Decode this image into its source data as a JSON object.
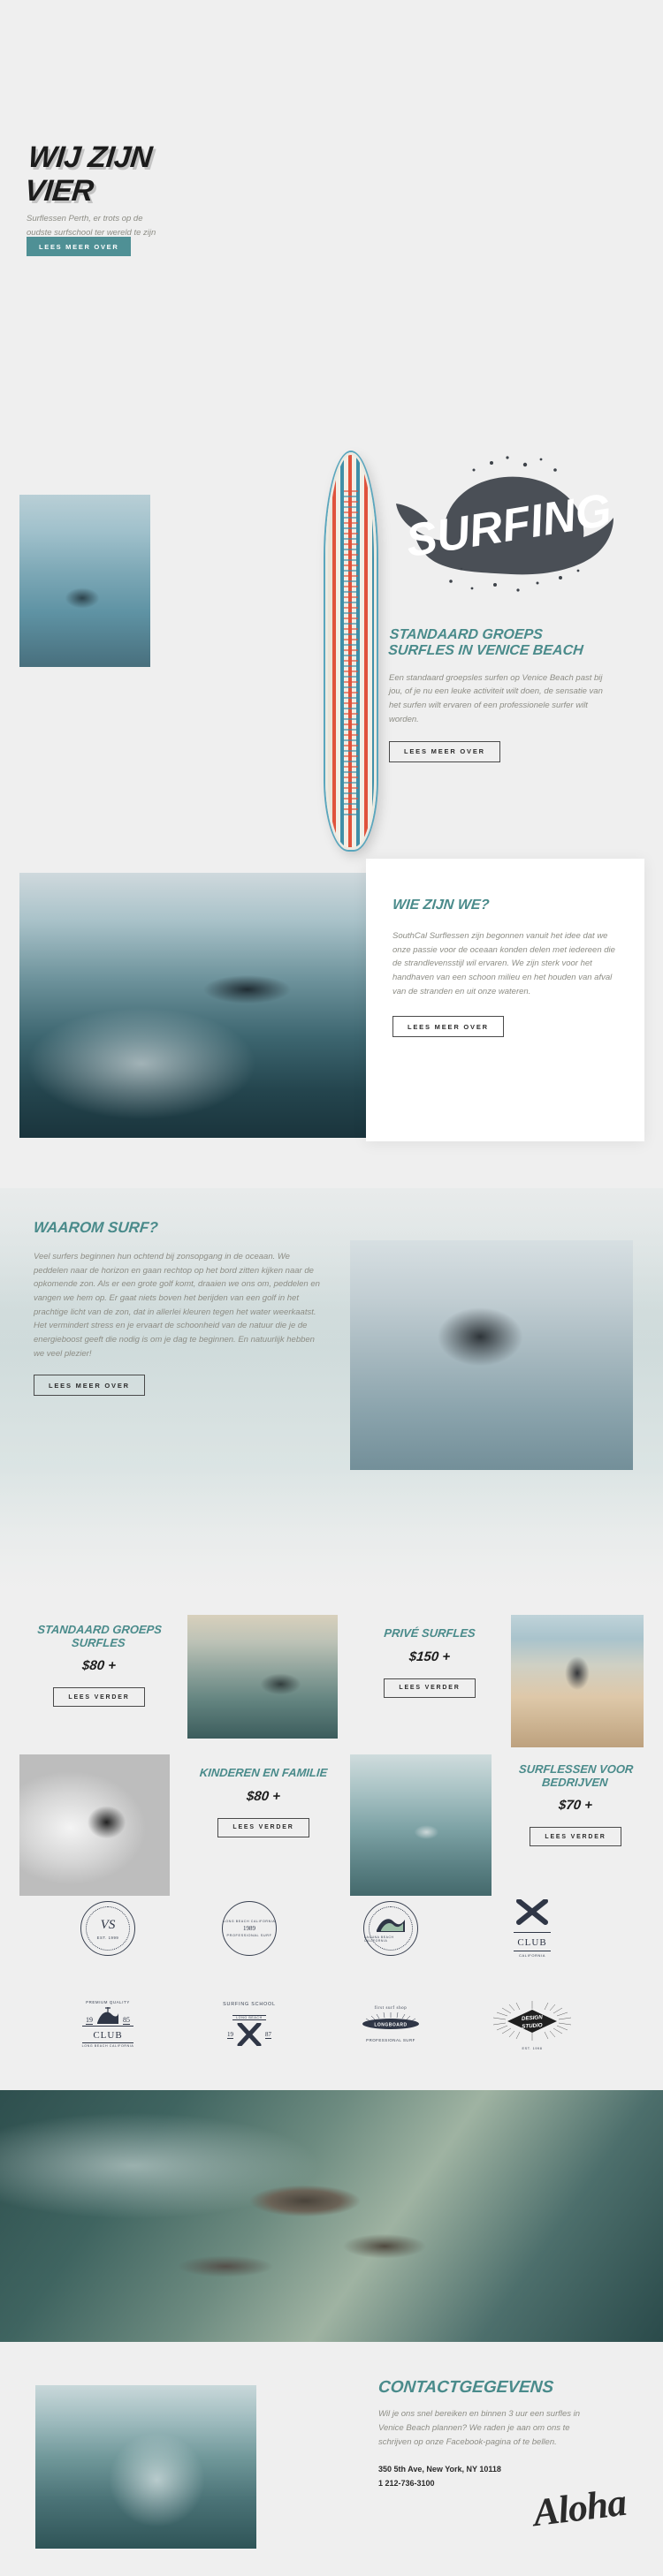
{
  "hero": {
    "title_line1": "WIJ ZIJN",
    "title_line2": "VIER",
    "subtitle": "Surflessen Perth, er trots op de oudste surfschool ter wereld te zijn",
    "cta": "LEES MEER OVER",
    "image_alt": "surfer-on-beach-photo"
  },
  "surfing": {
    "badge_word": "SURFING",
    "heading": "STANDAARD GROEPS SURFLES IN VENICE BEACH",
    "body": "Een standaard groepsles surfen op Venice Beach past bij jou, of je nu een leuke activiteit wilt doen, de sensatie van het surfen wilt ervaren of een professionele surfer wilt worden.",
    "cta": "LEES MEER OVER",
    "image_alt": "ocean-swimmer-photo",
    "board_alt": "striped-surfboard"
  },
  "about": {
    "heading": "WIE ZIJN WE?",
    "body": "SouthCal Surflessen zijn begonnen vanuit het idee dat we onze passie voor de oceaan konden delen met iedereen die de strandlevensstijl wil ervaren. We zijn sterk voor het handhaven van een schoon milieu en het houden van afval van de stranden en uit onze wateren.",
    "cta": "LEES MEER OVER",
    "image_alt": "big-wave-surfer-photo"
  },
  "why": {
    "heading": "WAAROM SURF?",
    "body": "Veel surfers beginnen hun ochtend bij zonsopgang in de oceaan. We peddelen naar de horizon en gaan rechtop op het bord zitten kijken naar de opkomende zon. Als er een grote golf komt, draaien we ons om, peddelen en vangen we hem op. Er gaat niets boven het berijden van een golf in het prachtige licht van de zon, dat in allerlei kleuren tegen het water weerkaatst. Het vermindert stress en je ervaart de schoonheid van de natuur die je de energieboost geeft die nodig is om je dag te beginnen. En natuurlijk hebben we veel plezier!",
    "cta": "LEES MEER OVER",
    "image_alt": "surfer-spray-photo"
  },
  "pricing": {
    "cards": [
      {
        "title": "STANDAARD GROEPS SURFLES",
        "price": "$80 +",
        "cta": "LEES VERDER",
        "image_alt": "surfer-in-water-sunset-photo"
      },
      {
        "title": "PRIVÉ SURFLES",
        "price": "$150 +",
        "cta": "LEES VERDER",
        "image_alt": "two-surfers-beach-photo"
      },
      {
        "title": "KINDEREN EN FAMILIE",
        "price": "$80 +",
        "cta": "LEES VERDER",
        "image_alt": "black-white-surfer-photo"
      },
      {
        "title": "SURFLESSEN VOOR BEDRIJVEN",
        "price": "$70 +",
        "cta": "LEES VERDER",
        "image_alt": "teal-ocean-surfer-photo"
      }
    ]
  },
  "logos": [
    {
      "name": "monogram-est-badge",
      "line1": "VS",
      "line2": "EST. 1999"
    },
    {
      "name": "professional-surf-badge",
      "line1": "LONG BEACH california",
      "line2": "1989",
      "line3": "PROFESSIONAL SURF"
    },
    {
      "name": "laguna-beach-wave-badge",
      "line1": "laguna beach california"
    },
    {
      "name": "x-club-badge",
      "line1": "CLUB",
      "line2": "CALIFORNIA"
    },
    {
      "name": "premium-quality-club-badge",
      "line1": "premium quality",
      "line2": "19",
      "line3": "85",
      "line4": "CLUB",
      "line5": "LONG BEACH california"
    },
    {
      "name": "surfing-school-badge",
      "line1": "SURFING SCHOOL",
      "line2": "LONG BEACH",
      "line3": "19",
      "line4": "87"
    },
    {
      "name": "first-surf-shop-badge",
      "line1": "first surf shop",
      "line2": "LONGBOARD",
      "line3": "PROFESSIONAL SURF"
    },
    {
      "name": "design-studio-diamond-badge",
      "line1": "DESIGN STUDIO",
      "line2": "EST. 1998"
    }
  ],
  "aerial": {
    "image_alt": "aerial-ocean-rocks-photo"
  },
  "contact": {
    "heading": "CONTACTGEGEVENS",
    "body": "Wil je ons snel bereiken en binnen 3 uur een surfles in Venice Beach plannen? We raden je aan om ons te schrijven op onze Facebook-pagina of te bellen.",
    "address": "350 5th Ave, New York, NY 10118",
    "phone": "1 212-736-3100",
    "signature": "Aloha",
    "image_alt": "wave-curl-photo"
  },
  "colors": {
    "teal": "#4a8b8b",
    "button_teal": "#4f9095",
    "dark": "#1c1c1c",
    "muted": "#8d8d85",
    "page_bg": "#efefef"
  }
}
